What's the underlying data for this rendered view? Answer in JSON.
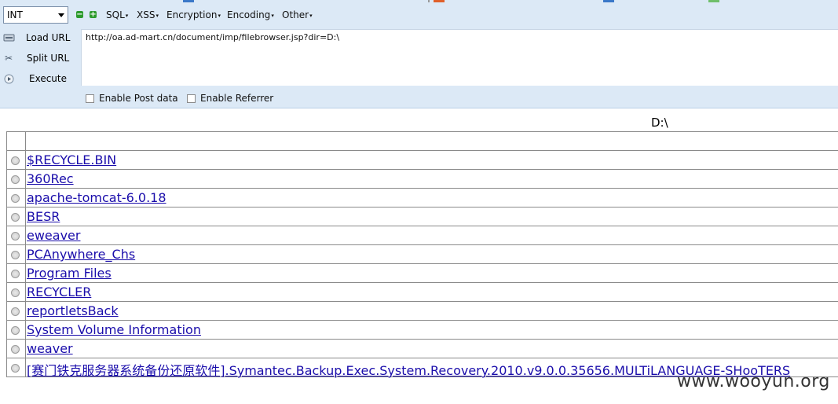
{
  "toolbar": {
    "select_value": "INT",
    "menus": [
      "SQL",
      "XSS",
      "Encryption",
      "Encoding",
      "Other"
    ]
  },
  "side_buttons": {
    "load": "Load URL",
    "split": "Split URL",
    "execute": "Execute"
  },
  "url": "http://oa.ad-mart.cn/document/imp/filebrowser.jsp?dir=D:\\",
  "options": {
    "post": "Enable Post data",
    "referrer": "Enable Referrer"
  },
  "page": {
    "dir_title": "D:\\",
    "entries": [
      "$RECYCLE.BIN",
      "360Rec",
      "apache-tomcat-6.0.18",
      "BESR",
      "eweaver",
      "PCAnywhere_Chs",
      "Program Files",
      "RECYCLER",
      "reportletsBack",
      "System Volume Information",
      "weaver",
      "[赛门铁克服务器系统备份还原软件].Symantec.Backup.Exec.System.Recovery.2010.v9.0.0.35656.MULTiLANGUAGE-SHooTERS"
    ]
  },
  "watermark": "www.wooyun.org",
  "colors": {
    "panel_bg": "#dce9f6",
    "link": "#1a0dab",
    "minus_green": "#2e9b2e",
    "plus_green": "#2e9b2e"
  }
}
